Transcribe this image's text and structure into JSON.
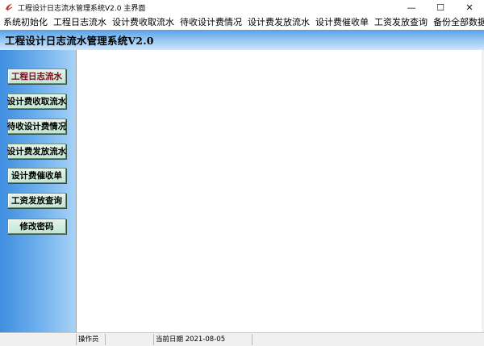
{
  "window": {
    "title": "工程设计日志流水管理系统V2.0 主界面",
    "minimize_glyph": "—",
    "maximize_glyph": "☐",
    "close_glyph": "✕"
  },
  "menu": {
    "items": [
      {
        "label": "系统初始化"
      },
      {
        "label": "工程日志流水"
      },
      {
        "label": "设计费收取流水"
      },
      {
        "label": "待收设计费情况"
      },
      {
        "label": "设计费发放流水"
      },
      {
        "label": "设计费催收单"
      },
      {
        "label": "工资发放查询"
      },
      {
        "label": "备份全部数据"
      }
    ]
  },
  "banner": {
    "title": "工程设计日志流水管理系统V2.0"
  },
  "sidebar": {
    "buttons": [
      {
        "label": "工程日志流水"
      },
      {
        "label": "设计费收取流水"
      },
      {
        "label": "待收设计费情况"
      },
      {
        "label": "设计费发放流水"
      },
      {
        "label": "设计费催收单"
      },
      {
        "label": "工资发放查询"
      },
      {
        "label": "修改密码"
      }
    ]
  },
  "status": {
    "operator_label": "操作员",
    "operator_value": "",
    "date_text": "当前日期 2021-08-05"
  },
  "icons": {
    "app": "app-logo-icon",
    "minimize": "minimize-icon",
    "maximize": "maximize-icon",
    "close": "close-icon"
  },
  "colors": {
    "banner_gradient_top": "#5aa0e6",
    "sidebar_gradient_left": "#3f8ee0",
    "button_face": "#c4e6d3",
    "active_button_text": "#7a0a1a"
  }
}
